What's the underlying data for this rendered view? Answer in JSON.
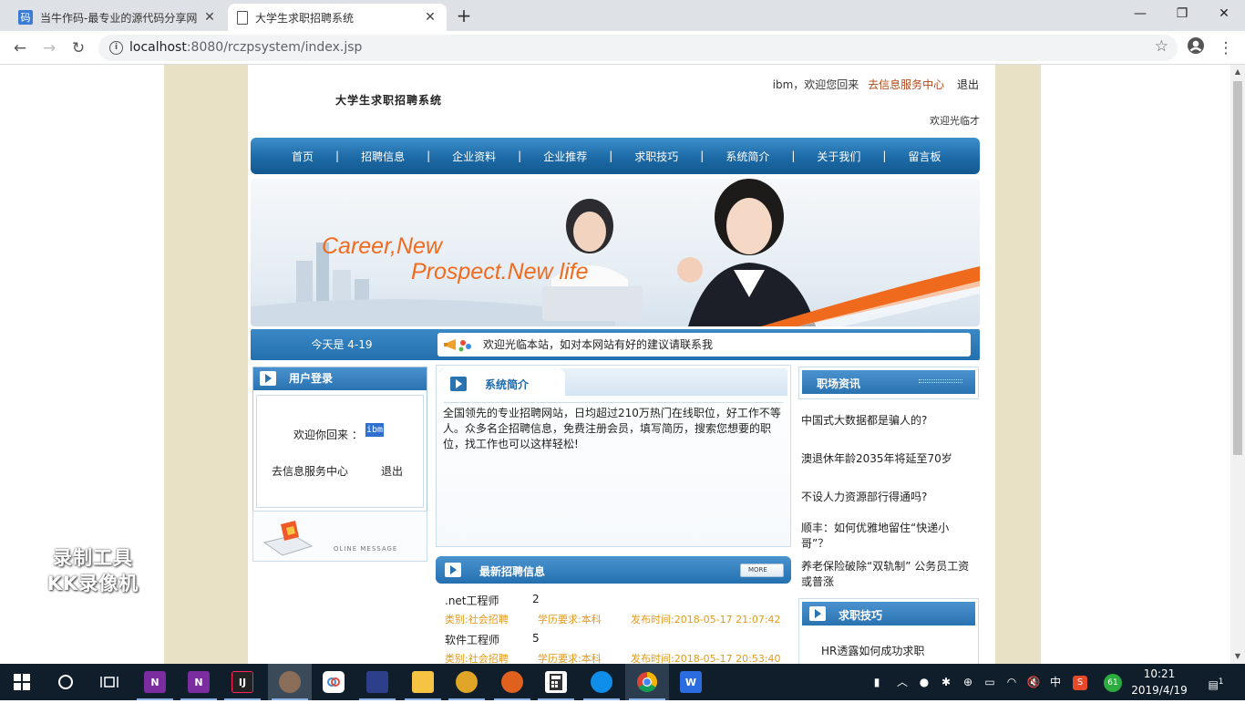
{
  "browser": {
    "tabs": [
      {
        "title": "当牛作码-最专业的源代码分享网",
        "favicon": "码"
      },
      {
        "title": "大学生求职招聘系统"
      }
    ],
    "url_host": "localhost",
    "url_rest": ":8080/rczpsystem/index.jsp"
  },
  "site": {
    "logo_text": "大学生求职招聘系统",
    "header": {
      "welcome": "ibm，欢迎您回来",
      "service_link": "去信息服务中心",
      "logout": "退出",
      "marquee": "欢迎光临才"
    },
    "nav": [
      "首页",
      "招聘信息",
      "企业资料",
      "企业推荐",
      "求职技巧",
      "系统简介",
      "关于我们",
      "留言板"
    ],
    "banner": {
      "line1": "Career,New",
      "line2": "Prospect.New life"
    },
    "today": "今天是 4-19",
    "notice": "欢迎光临本站，如对本网站有好的建议请联系我",
    "login": {
      "title": "用户登录",
      "welcome": "欢迎你回来 ：",
      "username": "ibm",
      "service_link": "去信息服务中心",
      "logout": "退出",
      "online_label": "OLINE MESSAGE"
    },
    "intro": {
      "title": "系统简介",
      "text": "全国领先的专业招聘网站，日均超过210万热门在线职位，好工作不等人。众多名企招聘信息，免费注册会员，填写简历，搜索您想要的职位，找工作也可以这样轻松!"
    },
    "jobs": {
      "title": "最新招聘信息",
      "more": "MORE",
      "items": [
        {
          "name": ".net工程师",
          "count": "2",
          "type": "类别:社会招聘",
          "edu": "学历要求:本科",
          "time": "发布时间:2018-05-17 21:07:42"
        },
        {
          "name": "软件工程师",
          "count": "5",
          "type": "类别:社会招聘",
          "edu": "学历要求:本科",
          "time": "发布时间:2018-05-17 20:53:40"
        }
      ]
    },
    "news": {
      "title": "职场资讯",
      "items": [
        "中国式大数据都是骗人的?",
        "澳退休年龄2035年将延至70岁",
        "不设人力资源部行得通吗?",
        "顺丰：如何优雅地留住“快递小哥”？",
        "养老保险破除“双轨制” 公务员工资或普涨"
      ]
    },
    "tips": {
      "title": "求职技巧",
      "items": [
        "HR透露如何成功求职"
      ]
    }
  },
  "watermark": {
    "line1": "录制工具",
    "line2": "KK录像机"
  },
  "taskbar": {
    "apps": [
      "N",
      "N",
      "IJ",
      "",
      "",
      "",
      "",
      "",
      "",
      "",
      "",
      "",
      ""
    ],
    "tray_ime": "中",
    "tray_badge": "61",
    "time": "10:21",
    "date": "2019/4/19",
    "notify_count": "1"
  }
}
